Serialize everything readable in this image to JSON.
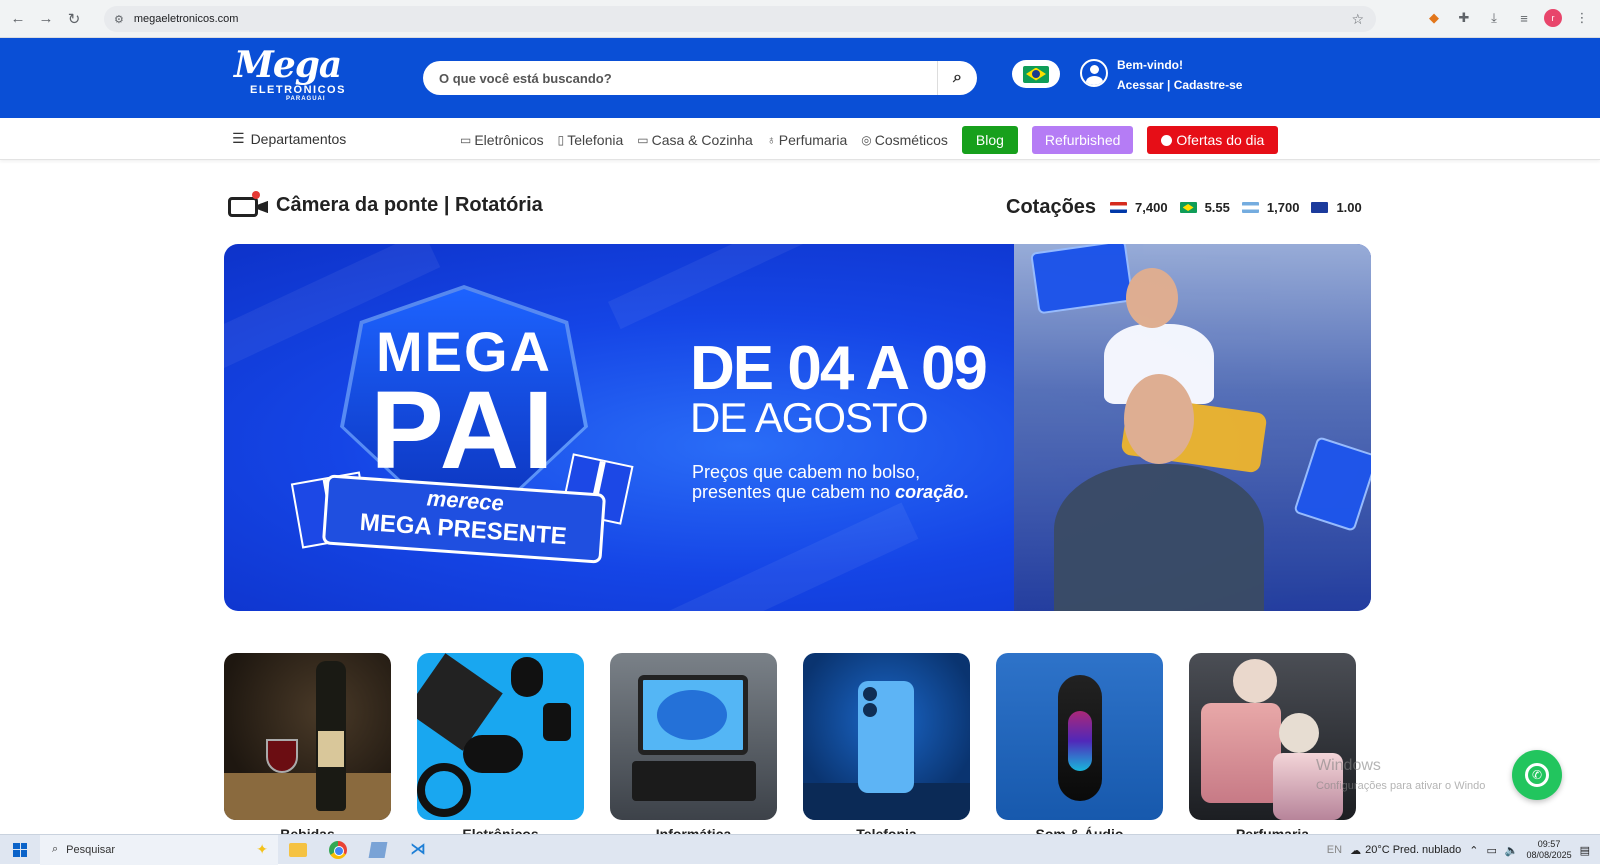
{
  "browser": {
    "url": "megaeletronicos.com"
  },
  "header": {
    "logo_main": "Mega",
    "logo_sub": "ELETRÔNICOS",
    "logo_sub2": "PARAGUAI",
    "search_placeholder": "O que você está buscando?",
    "welcome": "Bem-vindo!",
    "login_links": "Acessar | Cadastre-se"
  },
  "nav": {
    "departments": "Departamentos",
    "items": [
      {
        "label": "Eletrônicos"
      },
      {
        "label": "Telefonia"
      },
      {
        "label": "Casa & Cozinha"
      },
      {
        "label": "Perfumaria"
      },
      {
        "label": "Cosméticos"
      }
    ],
    "blog": "Blog",
    "refurbished": "Refurbished",
    "ofertas": "Ofertas do dia"
  },
  "camera": {
    "title": "Câmera da ponte | Rotatória"
  },
  "cotacoes": {
    "label": "Cotações",
    "rates": [
      {
        "flag": "paraguay",
        "value": "7,400"
      },
      {
        "flag": "brazil",
        "value": "5.55"
      },
      {
        "flag": "argentina",
        "value": "1,700"
      },
      {
        "flag": "europe",
        "value": "1.00"
      }
    ]
  },
  "banner": {
    "badge_top": "MEGA",
    "badge_main": "PAI",
    "ribbon_line1": "merece",
    "ribbon_line2": "MEGA PRESENTE",
    "date": "DE 04 A 09",
    "month": "DE AGOSTO",
    "tagline_1": "Preços que cabem no bolso,",
    "tagline_2a": "presentes que cabem no ",
    "tagline_2b": "coração."
  },
  "categories": [
    {
      "label": "Bebidas"
    },
    {
      "label": "Eletrônicos"
    },
    {
      "label": "Informática"
    },
    {
      "label": "Telefonia"
    },
    {
      "label": "Som & Áudio"
    },
    {
      "label": "Perfumaria"
    }
  ],
  "watermark": {
    "line1": "Windows",
    "line2": "Configurações para ativar o Windo"
  },
  "taskbar": {
    "search": "Pesquisar",
    "lang": "EN",
    "weather": "20°C  Pred. nublado",
    "time": "09:57",
    "date": "08/08/2025"
  }
}
